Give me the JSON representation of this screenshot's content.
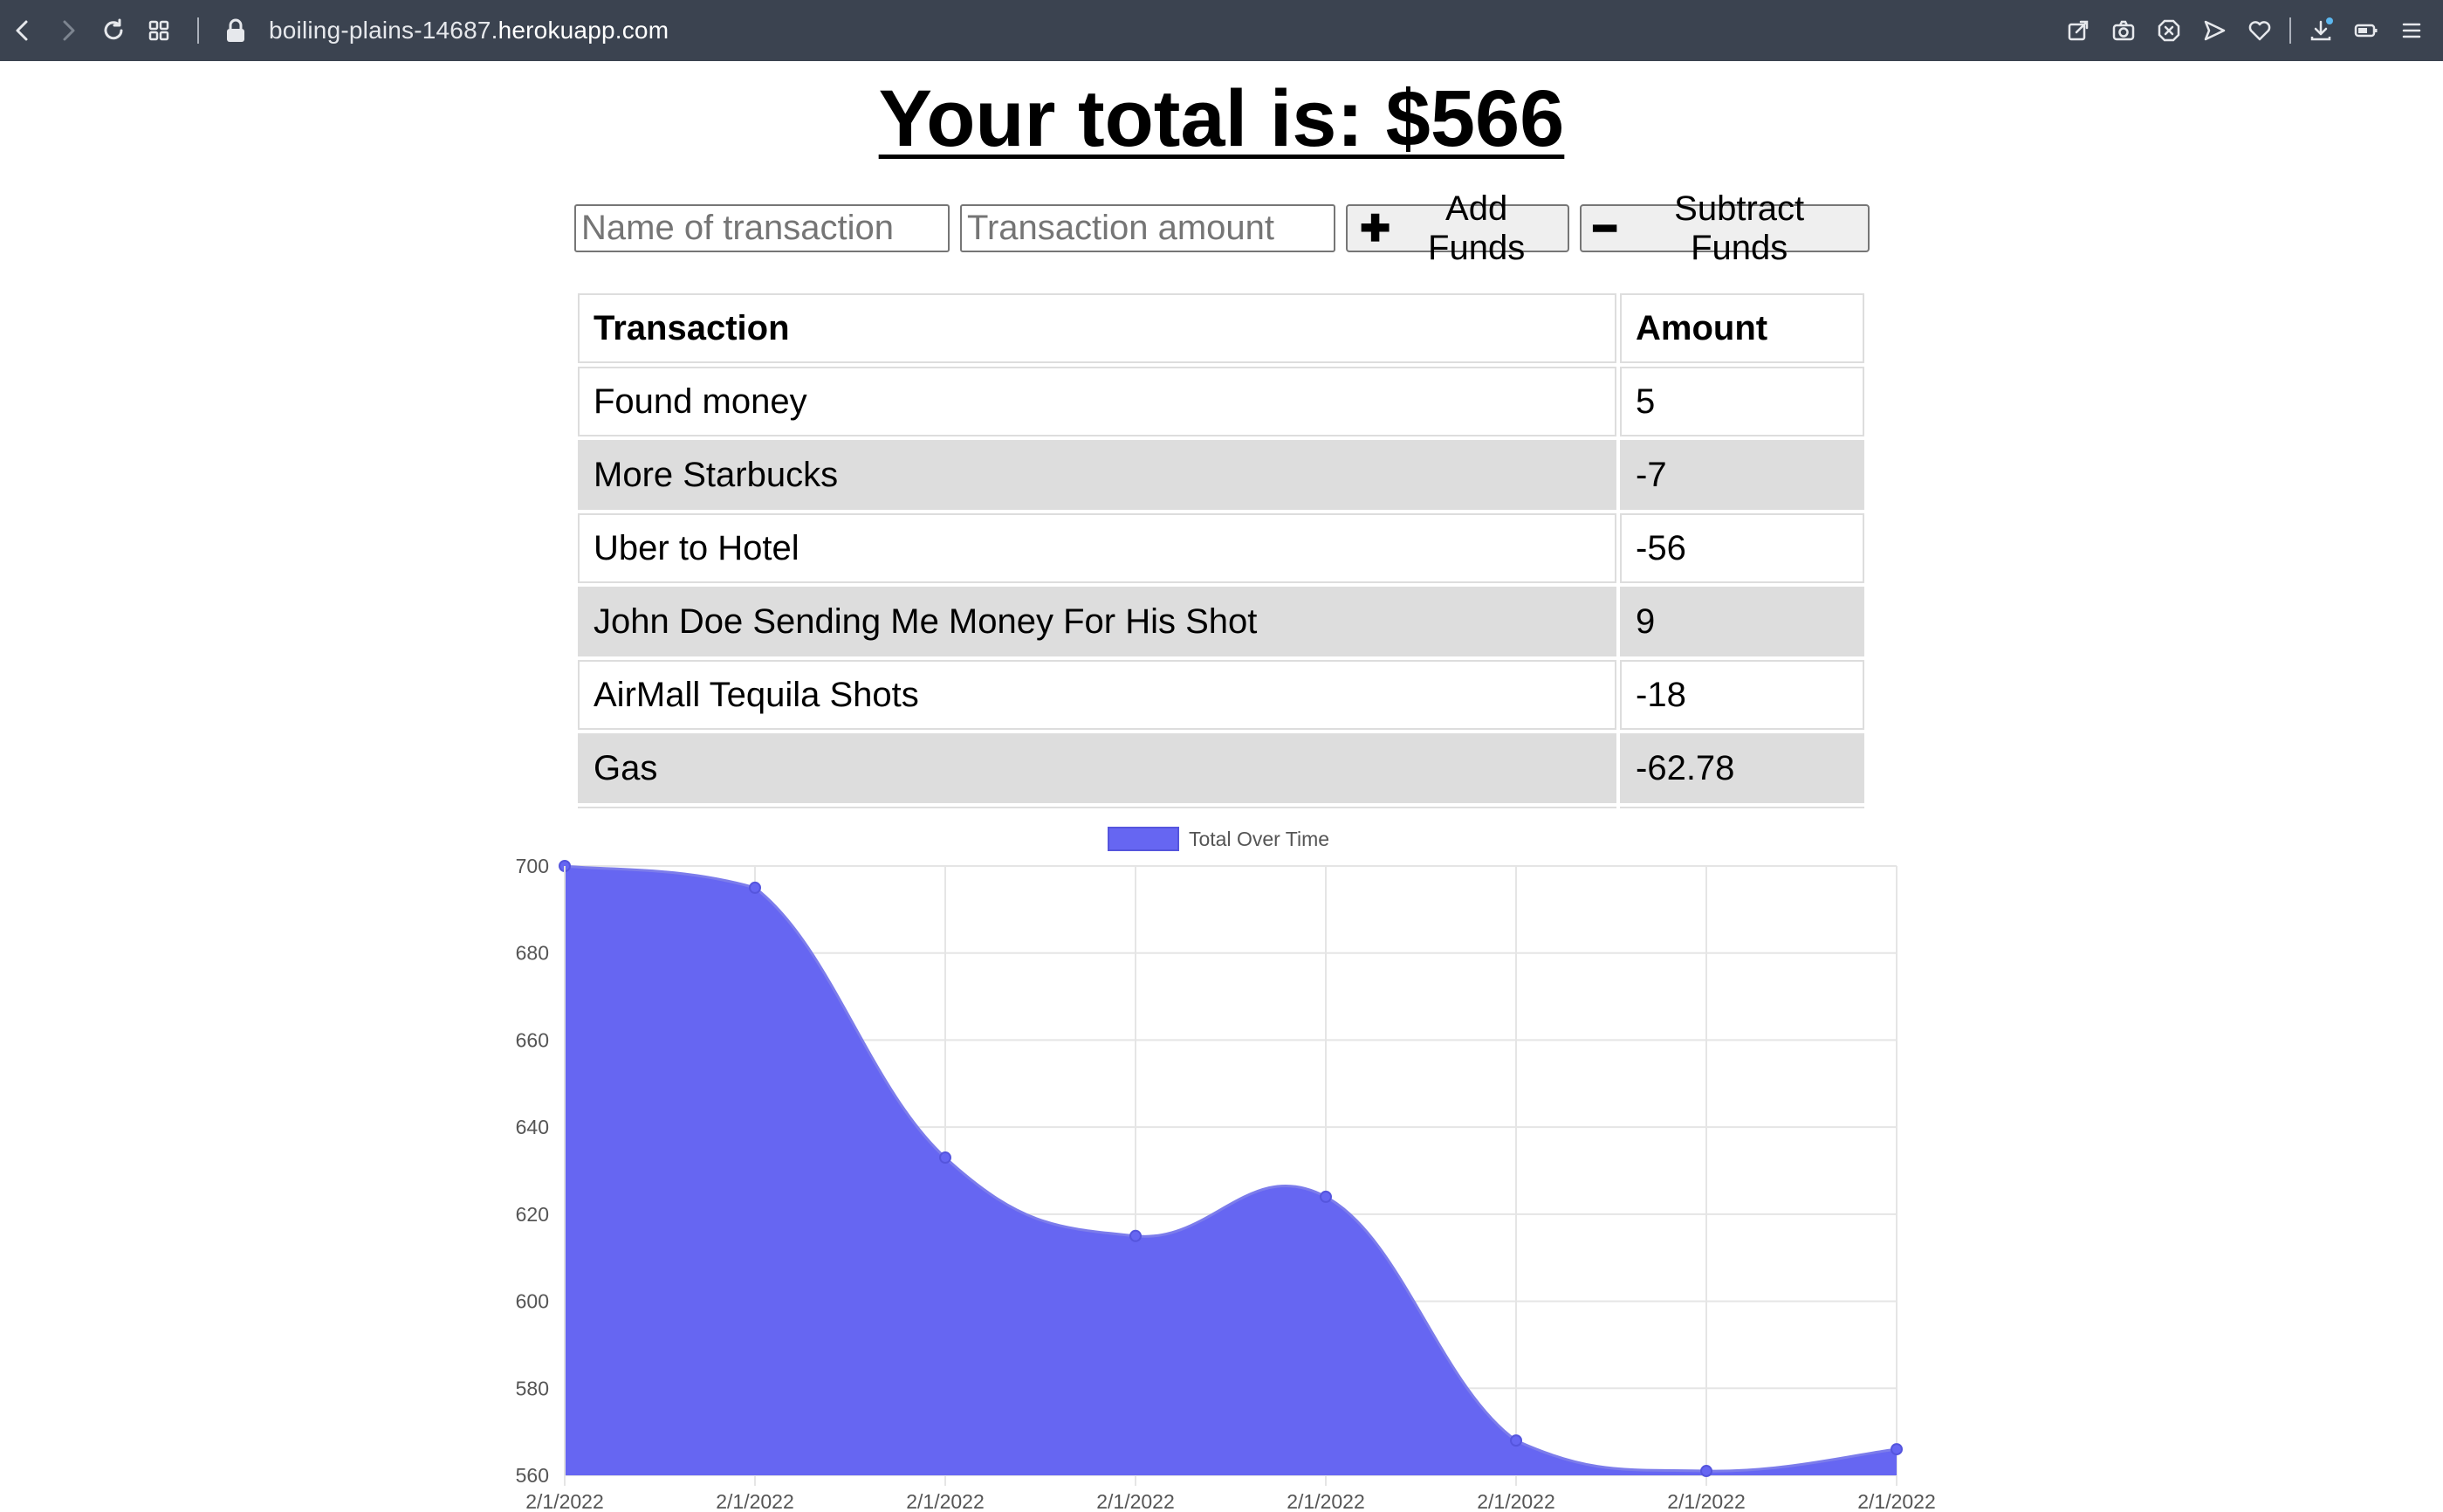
{
  "browser": {
    "url_prefix": "boiling-plains-14687.",
    "url_host": "herokuapp.com"
  },
  "page": {
    "title": "Your total is: $566"
  },
  "form": {
    "name_placeholder": "Name of transaction",
    "amount_placeholder": "Transaction amount",
    "add_label": "Add Funds",
    "subtract_label": "Subtract Funds"
  },
  "table": {
    "headers": [
      "Transaction",
      "Amount"
    ],
    "rows": [
      {
        "name": "Found money",
        "amount": "5"
      },
      {
        "name": "More Starbucks",
        "amount": "-7"
      },
      {
        "name": "Uber to Hotel",
        "amount": "-56"
      },
      {
        "name": "John Doe Sending Me Money For His Shot",
        "amount": "9"
      },
      {
        "name": "AirMall Tequila Shots",
        "amount": "-18"
      },
      {
        "name": "Gas",
        "amount": "-62.78"
      }
    ]
  },
  "chart_data": {
    "type": "area",
    "title": "",
    "xlabel": "",
    "ylabel": "",
    "legend": "top",
    "grid": true,
    "fill_color": "#6666f2",
    "line_color": "#6666f2",
    "categories": [
      "2/1/2022",
      "2/1/2022",
      "2/1/2022",
      "2/1/2022",
      "2/1/2022",
      "2/1/2022",
      "2/1/2022",
      "2/1/2022"
    ],
    "series": [
      {
        "name": "Total Over Time",
        "values": [
          700,
          695,
          633,
          615,
          624,
          568,
          561,
          566
        ]
      }
    ],
    "ylim": [
      560,
      700
    ],
    "yticks": [
      560,
      580,
      600,
      620,
      640,
      660,
      680,
      700
    ]
  }
}
